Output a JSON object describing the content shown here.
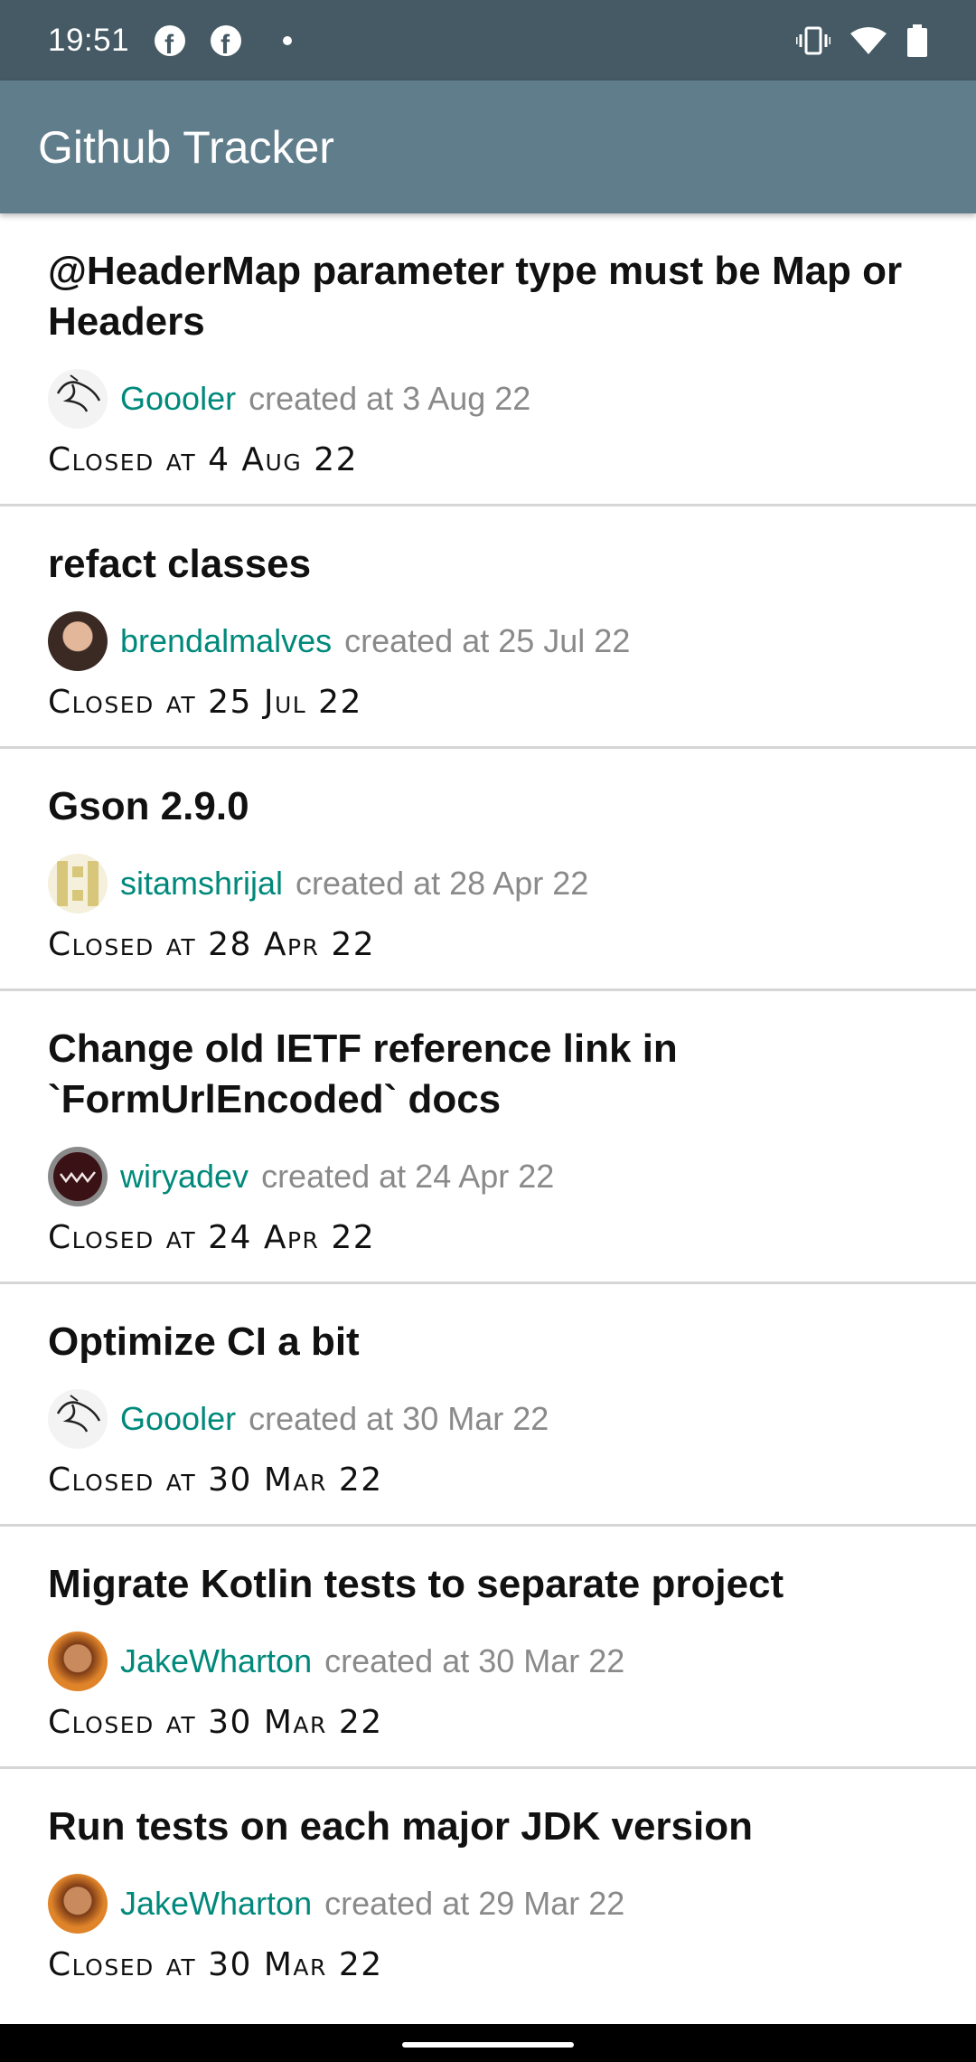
{
  "status_bar": {
    "time": "19:51",
    "icons": [
      "facebook-icon",
      "facebook-icon",
      "dot-icon",
      "vibrate-icon",
      "wifi-icon",
      "battery-icon"
    ]
  },
  "app_bar": {
    "title": "Github Tracker"
  },
  "issues": [
    {
      "title": "@HeaderMap parameter type must be Map or Headers",
      "author": "Goooler",
      "created": "created at 3 Aug 22",
      "closed": "Closed at 4 Aug 22",
      "avatar": "bird-logo"
    },
    {
      "title": "refact classes",
      "author": "brendalmalves",
      "created": "created at 25 Jul 22",
      "closed": "Closed at 25 Jul 22",
      "avatar": "photo"
    },
    {
      "title": "Gson 2.9.0",
      "author": "sitamshrijal",
      "created": "created at 28 Apr 22",
      "closed": "Closed at 28 Apr 22",
      "avatar": "identicon"
    },
    {
      "title": "Change old IETF reference link in `FormUrlEncoded` docs",
      "author": "wiryadev",
      "created": "created at 24 Apr 22",
      "closed": "Closed at 24 Apr 22",
      "avatar": "badge"
    },
    {
      "title": "Optimize CI a bit",
      "author": "Goooler",
      "created": "created at 30 Mar 22",
      "closed": "Closed at 30 Mar 22",
      "avatar": "bird-logo"
    },
    {
      "title": "Migrate Kotlin tests to separate project",
      "author": "JakeWharton",
      "created": "created at 30 Mar 22",
      "closed": "Closed at 30 Mar 22",
      "avatar": "photo-warm"
    },
    {
      "title": "Run tests on each major JDK version",
      "author": "JakeWharton",
      "created": "created at 29 Mar 22",
      "closed": "Closed at 30 Mar 22",
      "avatar": "photo-warm"
    }
  ],
  "colors": {
    "status_bar": "#455a64",
    "app_bar": "#607d8b",
    "author_link": "#00897b",
    "secondary_text": "#8a8a8a"
  }
}
